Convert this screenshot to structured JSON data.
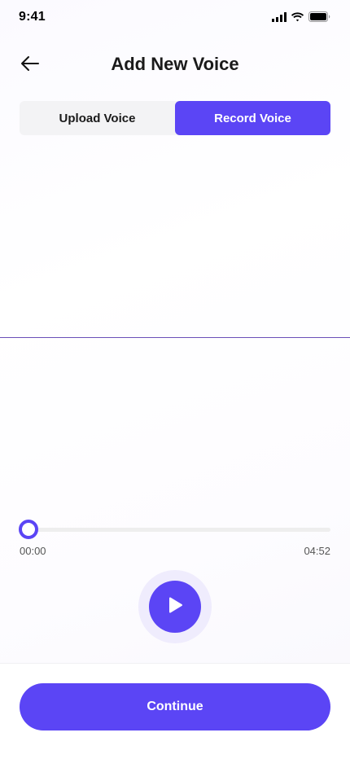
{
  "status_bar": {
    "time": "9:41",
    "icons": [
      "cellular-signal-icon",
      "wifi-icon",
      "battery-icon"
    ]
  },
  "header": {
    "back_icon": "arrow-left-icon",
    "title": "Add New Voice"
  },
  "tabs": [
    {
      "label": "Upload Voice",
      "active": false
    },
    {
      "label": "Record Voice",
      "active": true
    }
  ],
  "player": {
    "current_time": "00:00",
    "total_time": "04:52",
    "progress": 0,
    "play_icon": "play-icon"
  },
  "footer": {
    "continue_label": "Continue"
  },
  "colors": {
    "accent": "#5b45f5",
    "accent_light": "#efecfd",
    "wave_line": "#6a4fb8",
    "track": "#eeeeee"
  }
}
